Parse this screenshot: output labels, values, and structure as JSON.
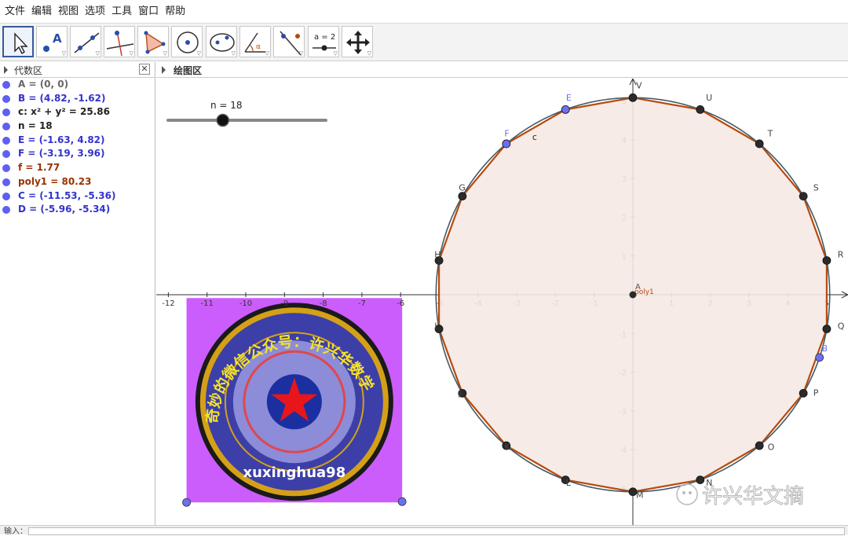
{
  "menu": [
    "文件",
    "编辑",
    "视图",
    "选项",
    "工具",
    "窗口",
    "帮助"
  ],
  "toolbar": {
    "tools": [
      {
        "name": "move-tool",
        "icon": "cursor-arrow-icon",
        "selected": true
      },
      {
        "name": "point-tool",
        "icon": "point-a-icon",
        "label": "A"
      },
      {
        "name": "line-tool",
        "icon": "line-through-points-icon"
      },
      {
        "name": "perpendicular-tool",
        "icon": "perpendicular-line-icon"
      },
      {
        "name": "polygon-tool",
        "icon": "polygon-icon"
      },
      {
        "name": "circle-tool",
        "icon": "circle-center-point-icon"
      },
      {
        "name": "ellipse-tool",
        "icon": "ellipse-icon"
      },
      {
        "name": "angle-tool",
        "icon": "angle-icon",
        "label": "α"
      },
      {
        "name": "reflect-tool",
        "icon": "reflect-line-icon"
      },
      {
        "name": "slider-tool",
        "icon": "slider-icon",
        "label": "a = 2"
      },
      {
        "name": "move-view-tool",
        "icon": "move-arrows-icon"
      }
    ]
  },
  "algebra": {
    "title": "代数区",
    "close": "✕",
    "items": [
      {
        "text": "A = (0, 0)",
        "color": "#666666",
        "dot": "#5f5ff2"
      },
      {
        "text": "B = (4.82, -1.62)",
        "color": "#3333cc",
        "dot": "#5f5ff2"
      },
      {
        "text": "c: x² + y² = 25.86",
        "color": "#222222",
        "dot": "#5f5ff2"
      },
      {
        "text": "n = 18",
        "color": "#222222",
        "dot": "#5f5ff2"
      },
      {
        "text": "E = (-1.63, 4.82)",
        "color": "#3333cc",
        "dot": "#5f5ff2"
      },
      {
        "text": "F = (-3.19, 3.96)",
        "color": "#3333cc",
        "dot": "#5f5ff2"
      },
      {
        "text": "f = 1.77",
        "color": "#993300",
        "dot": "#5f5ff2"
      },
      {
        "text": "poly1 = 80.23",
        "color": "#993300",
        "dot": "#5f5ff2"
      },
      {
        "text": "C = (-11.53, -5.36)",
        "color": "#3333cc",
        "dot": "#5f5ff2"
      },
      {
        "text": "D = (-5.96, -5.34)",
        "color": "#3333cc",
        "dot": "#5f5ff2"
      }
    ]
  },
  "graphics": {
    "title": "绘图区",
    "slider": {
      "label": "n = 18",
      "value": 18,
      "min": 1,
      "max": 50
    },
    "circle": {
      "name": "c",
      "radius": 5.0855
    },
    "polygon": {
      "name": "poly1",
      "sides": 18
    },
    "origin_label": "A",
    "x_ticks": [
      "-12",
      "-11",
      "-10",
      "-9",
      "-8",
      "-7",
      "-6",
      "-5",
      "-4",
      "-3",
      "-2",
      "-1",
      "1",
      "2",
      "3",
      "4",
      "5"
    ],
    "y_ticks": [
      "5",
      "4",
      "3",
      "2",
      "1",
      "-1",
      "-2",
      "-3",
      "-4",
      "-5"
    ],
    "vertices": [
      {
        "label": "V",
        "deg": 90,
        "kind": "dark"
      },
      {
        "label": "U",
        "deg": 70,
        "kind": "dark"
      },
      {
        "label": "T",
        "deg": 50,
        "kind": "dark"
      },
      {
        "label": "S",
        "deg": 30,
        "kind": "dark"
      },
      {
        "label": "R",
        "deg": 10,
        "kind": "dark"
      },
      {
        "label": "Q",
        "deg": -10,
        "kind": "dark"
      },
      {
        "label": "P",
        "deg": -30,
        "kind": "dark"
      },
      {
        "label": "O",
        "deg": -50,
        "kind": "dark"
      },
      {
        "label": "N",
        "deg": -70,
        "kind": "dark"
      },
      {
        "label": "M",
        "deg": -90,
        "kind": "dark"
      },
      {
        "label": "L",
        "deg": -110,
        "kind": "dark"
      },
      {
        "label": "K",
        "deg": -130,
        "kind": "dark"
      },
      {
        "label": "J",
        "deg": -150,
        "kind": "dark"
      },
      {
        "label": "I",
        "deg": -170,
        "kind": "dark"
      },
      {
        "label": "H",
        "deg": 170,
        "kind": "dark"
      },
      {
        "label": "G",
        "deg": 150,
        "kind": "dark"
      },
      {
        "label": "F",
        "deg": 130,
        "kind": "blue"
      },
      {
        "label": "E",
        "deg": 110,
        "kind": "blue"
      }
    ],
    "free_point": {
      "label": "B",
      "x": 4.82,
      "y": -1.62
    },
    "image_corners": [
      {
        "label": "C",
        "x": -11.53,
        "y": -5.36
      },
      {
        "label": "D",
        "x": -5.96,
        "y": -5.34
      }
    ],
    "badge": {
      "arc_text": "奇妙的微信公众号：许兴华数学",
      "sub_text": "xuxinghua98"
    },
    "watermark": "许兴华文摘",
    "colors": {
      "polygon_fill": "#f5e9e3",
      "polygon_edge": "#b84a0e",
      "circle": "#455a64",
      "axis": "#333333",
      "dark_point": "#2b2b2b",
      "blue_point": "#6e6ef0",
      "image_bg": "#cb5dfc"
    }
  },
  "input": {
    "label": "输入："
  }
}
